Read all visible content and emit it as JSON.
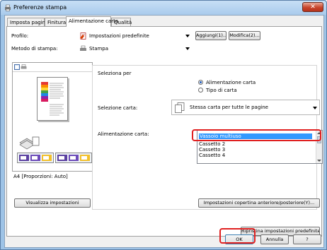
{
  "window": {
    "title": "Preferenze stampa",
    "close_label": "✕"
  },
  "tabs": [
    {
      "label": "Imposta pagina"
    },
    {
      "label": "Finitura"
    },
    {
      "label": "Alimentazione carta"
    },
    {
      "label": "Qualità"
    }
  ],
  "profile": {
    "label": "Profilo:",
    "value": "Impostazioni predefinite",
    "add_button": "Aggiungi(1)...",
    "edit_button": "Modifica(2)..."
  },
  "print_method": {
    "label": "Metodo di stampa:",
    "value": "Stampa"
  },
  "preview": {
    "caption": "A4 [Proporzioni: Auto]"
  },
  "select_by": {
    "label": "Seleziona per",
    "options": [
      {
        "label": "Alimentazione carta",
        "selected": true
      },
      {
        "label": "Tipo di carta",
        "selected": false
      }
    ]
  },
  "paper_selection": {
    "label": "Selezione carta:",
    "value": "Stessa carta per tutte le pagine"
  },
  "paper_source": {
    "label": "Alimentazione carta:",
    "items": [
      "Vassoio multiuso",
      "Cassetto 2",
      "Cassetto 3",
      "Cassetto 4"
    ],
    "selected_index": 0
  },
  "buttons": {
    "view_settings": "Visualizza impostazioni",
    "cover_settings": "Impostazioni copertina anteriore/posteriore(Y)...",
    "restore_defaults": "Ripristina impostazioni predefinite",
    "ok": "OK",
    "cancel": "Annulla",
    "help": "?"
  },
  "colors": {
    "highlight": "#e02020",
    "selection": "#3399ff",
    "titlebar": "#a9cbec"
  }
}
